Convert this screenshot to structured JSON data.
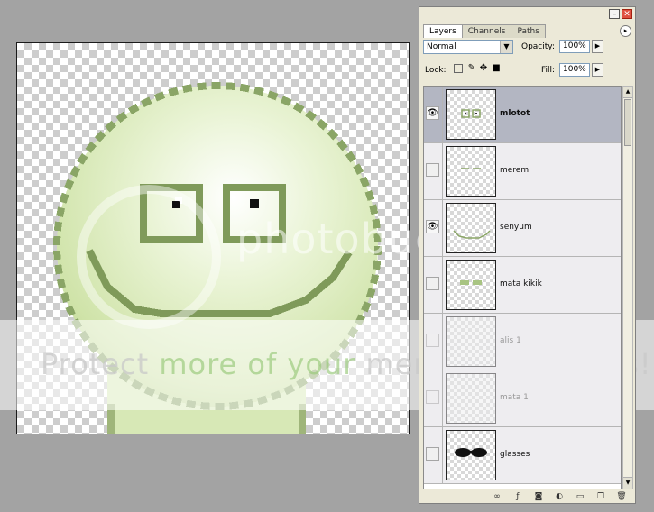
{
  "panel": {
    "tabs": [
      "Layers",
      "Channels",
      "Paths"
    ],
    "active_tab": "Layers",
    "blend_mode": "Normal",
    "opacity_label": "Opacity:",
    "opacity_value": "100%",
    "lock_label": "Lock:",
    "fill_label": "Fill:",
    "fill_value": "100%",
    "layers": [
      {
        "name": "mlotot",
        "visible": true,
        "selected": true
      },
      {
        "name": "merem",
        "visible": false
      },
      {
        "name": "senyum",
        "visible": true
      },
      {
        "name": "mata kikik",
        "visible": false
      },
      {
        "name": "alis 1",
        "visible": false
      },
      {
        "name": "mata 1",
        "visible": false
      },
      {
        "name": "glasses",
        "visible": false
      }
    ]
  },
  "watermark": {
    "logo": "photobucket",
    "tagline_a": "Protect ",
    "tagline_b": "more of your",
    "tagline_c": " memories for less!"
  },
  "colors": {
    "face_light": "#eef6dc",
    "face_mid": "#cfe3a8",
    "face_dark": "#7f9a5a",
    "selected_layer": "#b3b6c2"
  },
  "icons": [
    "eye-icon",
    "minimize-icon",
    "close-icon",
    "panel-menu-icon",
    "link-icon",
    "fx-icon",
    "mask-icon",
    "adjustment-icon",
    "folder-icon",
    "new-layer-icon",
    "trash-icon"
  ]
}
